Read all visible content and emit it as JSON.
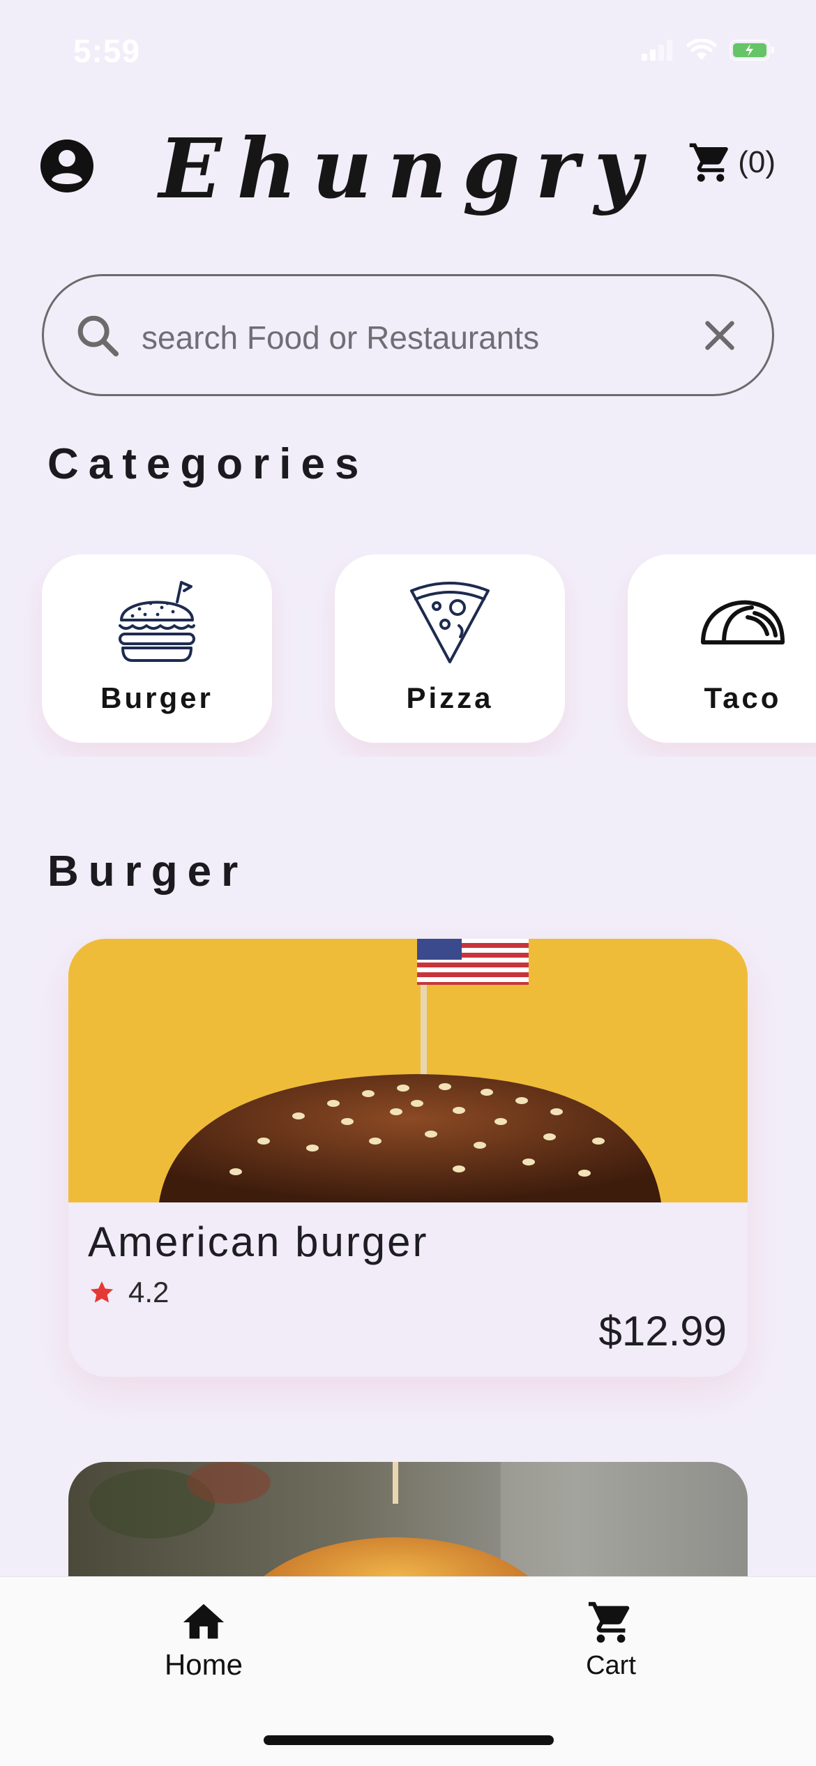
{
  "status_bar": {
    "time": "5:59",
    "icons": [
      "signal-icon",
      "wifi-icon",
      "battery-charging-icon"
    ]
  },
  "header": {
    "profile_icon": "account-circle-icon",
    "brand": "Ehungry",
    "cart_icon": "shopping-cart-icon",
    "cart_count": "(0)"
  },
  "search": {
    "placeholder": "search Food or Restaurants",
    "value": "",
    "search_icon": "search-icon",
    "clear_icon": "close-icon"
  },
  "categories": {
    "title": "Categories",
    "items": [
      {
        "label": "Burger",
        "icon": "burger-icon"
      },
      {
        "label": "Pizza",
        "icon": "pizza-icon"
      },
      {
        "label": "Taco",
        "icon": "taco-icon"
      }
    ]
  },
  "section": {
    "title": "Burger",
    "items": [
      {
        "name": "American burger",
        "rating": "4.2",
        "price": "$12.99",
        "rating_icon": "star-icon"
      }
    ]
  },
  "bottom_nav": {
    "items": [
      {
        "label": "Home",
        "icon": "home-icon"
      },
      {
        "label": "Cart",
        "icon": "shopping-cart-icon"
      }
    ]
  },
  "colors": {
    "background": "#f2eef9",
    "card": "#ffffff",
    "category_icon": "#1d2b4f",
    "star": "#e53935",
    "photo_background": "#f2c33f"
  }
}
